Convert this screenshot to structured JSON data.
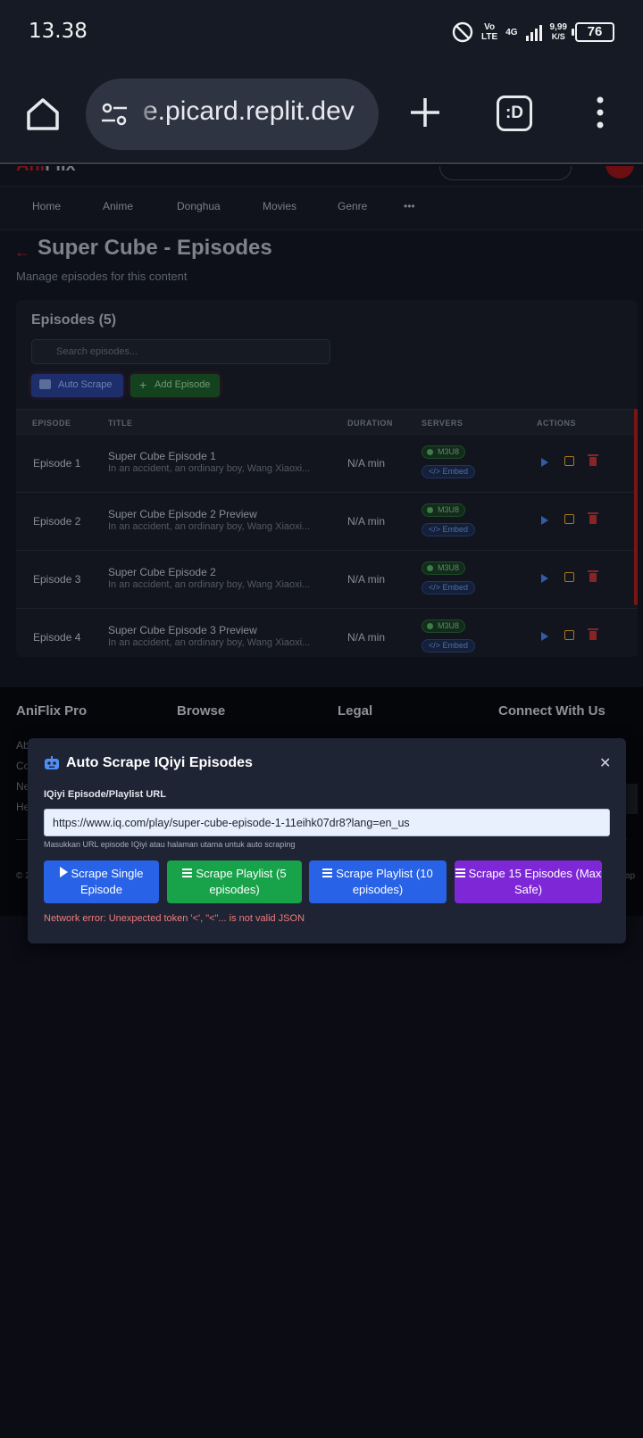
{
  "status_bar": {
    "time": "13.38",
    "volte": "Vo\nLTE",
    "network": "4G",
    "speed": "9,99",
    "speed_unit": "K/S",
    "battery": "76"
  },
  "browser": {
    "url": "e.picard.replit.dev",
    "tabs_label": ":D"
  },
  "site": {
    "logo_part1": "Ani",
    "logo_part2": "Flix",
    "nav": [
      "Home",
      "Anime",
      "Donghua",
      "Movies",
      "Genre",
      "•••"
    ]
  },
  "page": {
    "title": "Super Cube - Episodes",
    "subtitle": "Manage episodes for this content"
  },
  "episodes_card": {
    "title": "Episodes (5)",
    "search_placeholder": "Search episodes...",
    "auto_scrape_label": "Auto Scrape",
    "add_episode_label": "Add Episode",
    "columns": [
      "EPISODE",
      "TITLE",
      "DURATION",
      "SERVERS",
      "ACTIONS"
    ],
    "rows": [
      {
        "episode": "Episode 1",
        "title": "Super Cube Episode 1",
        "desc": "In an accident, an ordinary boy, Wang Xiaoxi...",
        "duration": "N/A min",
        "m3u8": "M3U8",
        "embed": "</> Embed"
      },
      {
        "episode": "Episode 2",
        "title": "Super Cube Episode 2 Preview",
        "desc": "In an accident, an ordinary boy, Wang Xiaoxi...",
        "duration": "N/A min",
        "m3u8": "M3U8",
        "embed": "</> Embed"
      },
      {
        "episode": "Episode 3",
        "title": "Super Cube Episode 2",
        "desc": "In an accident, an ordinary boy, Wang Xiaoxi...",
        "duration": "N/A min",
        "m3u8": "M3U8",
        "embed": "</> Embed"
      },
      {
        "episode": "Episode 4",
        "title": "Super Cube Episode 3 Preview",
        "desc": "In an accident, an ordinary boy, Wang Xiaoxi...",
        "duration": "N/A min",
        "m3u8": "M3U8",
        "embed": "</> Embed"
      }
    ]
  },
  "footer": {
    "headings": [
      "AniFlix Pro",
      "Browse",
      "Legal",
      "Connect With Us"
    ],
    "fragments": [
      "Ab",
      "Co",
      "Ne",
      "He",
      "© 2",
      "ap"
    ]
  },
  "modal": {
    "title": "Auto Scrape IQiyi Episodes",
    "close": "✕",
    "field_label": "IQiyi Episode/Playlist URL",
    "url_value": "https://www.iq.com/play/super-cube-episode-1-11eihk07dr8?lang=en_us",
    "hint": "Masukkan URL episode IQiyi atau halaman utama untuk auto scraping",
    "buttons": [
      {
        "label": "Scrape Single Episode",
        "color": "#2862e6"
      },
      {
        "label": "Scrape Playlist (5 episodes)",
        "color": "#18a34a"
      },
      {
        "label": "Scrape Playlist (10 episodes)",
        "color": "#2862e6"
      },
      {
        "label": "Scrape 15 Episodes (Max Safe)",
        "color": "#7e27d7"
      }
    ],
    "error": "Network error: Unexpected token '<', \"<\"... is not valid JSON"
  }
}
